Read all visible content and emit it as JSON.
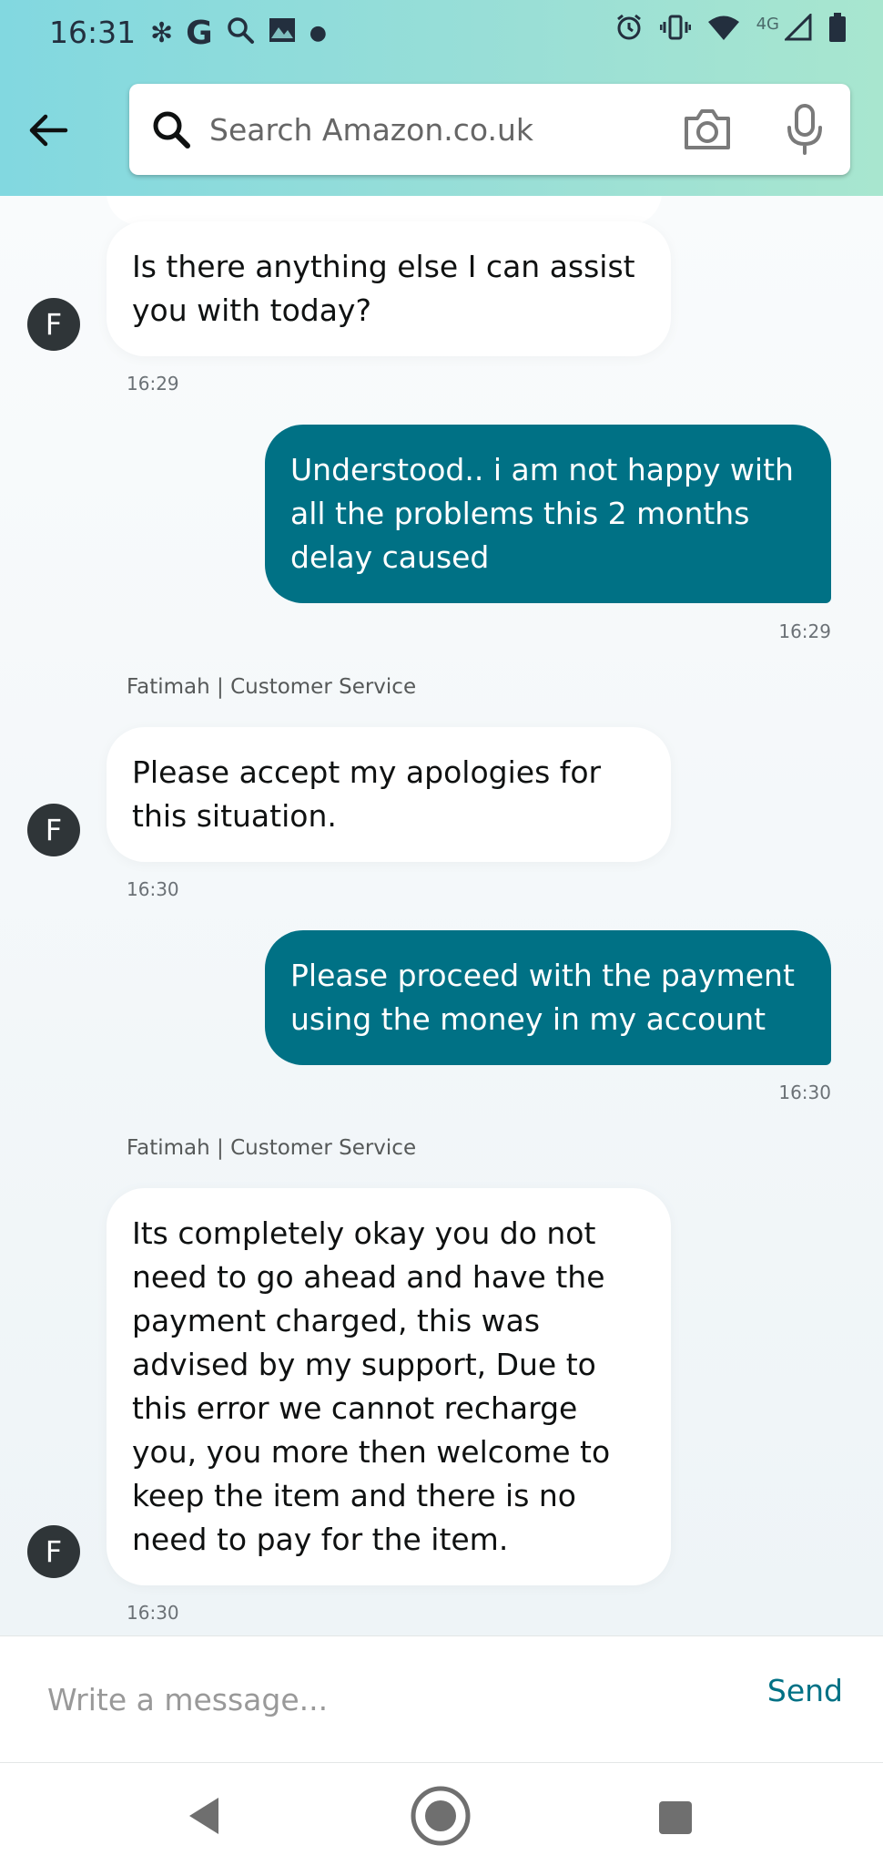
{
  "status_bar": {
    "time": "16:31",
    "left_icons": [
      "bluetooth-icon",
      "google-icon",
      "search-icon",
      "gallery-icon",
      "dot-icon"
    ],
    "network_label": "4G",
    "right_icons": [
      "alarm-icon",
      "vibrate-icon",
      "wifi-icon",
      "signal-icon",
      "battery-icon"
    ]
  },
  "header": {
    "back_icon": "back-arrow-icon",
    "search": {
      "placeholder": "Search Amazon.co.uk",
      "value": ""
    },
    "camera_icon": "camera-icon",
    "mic_icon": "microphone-icon"
  },
  "chat": {
    "agent_initial": "F",
    "messages": [
      {
        "from": "agent",
        "text": "Is there anything else I can assist you with today?",
        "time": "16:29"
      },
      {
        "from": "user",
        "text": "Understood.. i am not happy with all the problems this 2 months delay caused",
        "time": "16:29"
      },
      {
        "from": "agent",
        "sender": "Fatimah | Customer Service",
        "text": "Please accept my apologies for this situation.",
        "time": "16:30"
      },
      {
        "from": "user",
        "text": "Please proceed with the payment using the money in my account",
        "time": "16:30"
      },
      {
        "from": "agent",
        "sender": "Fatimah | Customer Service",
        "text": "Its completely okay you do not need to go ahead and have the payment charged, this was advised by my support, Due to this error we cannot recharge you, you more then welcome to keep the item and there is no need to pay for the item.",
        "time": "16:30"
      }
    ]
  },
  "composer": {
    "placeholder": "Write a message...",
    "value": "",
    "send_label": "Send"
  },
  "nav_bar": {
    "icons": [
      "nav-back-icon",
      "nav-home-icon",
      "nav-recents-icon"
    ]
  },
  "colors": {
    "accent": "#007185",
    "user_bubble": "#007185",
    "agent_bubble": "#ffffff",
    "header_gradient_start": "#82d8e0",
    "header_gradient_end": "#a8e6cf",
    "avatar": "#2f3538"
  }
}
